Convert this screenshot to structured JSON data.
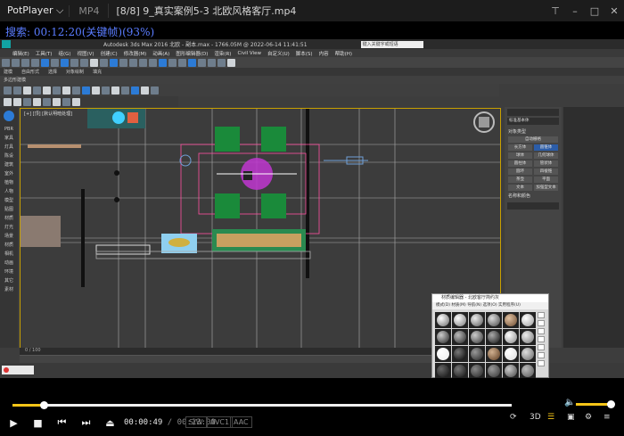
{
  "player": {
    "brand": "PotPlayer",
    "format": "MP4",
    "file_title": "[8/8] 9_真实案例5-3 北欧风格客厅.mp4",
    "osd_text": "搜索: 00:12:20(关键帧)(93%)",
    "current_time": "00:00:49",
    "total_time": "00:13:09",
    "codecs": [
      "S/W",
      "AVC1",
      "AAC"
    ],
    "progress_fraction": 0.062,
    "volume_fraction": 1.0,
    "colors": {
      "accent": "#f5c518",
      "osd": "#5a7cff"
    }
  },
  "max": {
    "title": "Autodesk 3ds Max 2016    北欧 - 副本.max - 1766.05M @ 2022-06-14 11:41:51",
    "search_placeholder": "键入关键字或短语",
    "menu": [
      "编辑(E)",
      "工具(T)",
      "组(G)",
      "视图(V)",
      "创建(C)",
      "修改器(M)",
      "动画(A)",
      "图形编辑器(D)",
      "渲染(R)",
      "Civil View",
      "自定义(U)",
      "脚本(S)",
      "内容",
      "帮助(H)"
    ],
    "ribbon_tabs": [
      "建模",
      "自由形式",
      "选择",
      "对象绘制",
      "填充"
    ],
    "subtab": "多边形建模",
    "left_nav": [
      "PBR",
      "家具",
      "灯具",
      "陈设",
      "建筑",
      "室外",
      "植物",
      "人物",
      "模型",
      "贴图",
      "材质",
      "灯光",
      "场景",
      "材质",
      "相机",
      "动画",
      "环境",
      "其它",
      "素材"
    ],
    "viewport_label": "[+] [顶] [默认明暗处理]",
    "timeline_label": "0 / 100",
    "cmd_panel": {
      "object_type_header": "对象类型",
      "dropdown": "标准基本体",
      "autogrid": "自动栅格",
      "buttons": [
        "长方体",
        "圆锥体",
        "球体",
        "几何球体",
        "圆柱体",
        "管状体",
        "圆环",
        "四棱锥",
        "茶壶",
        "平面",
        "文本",
        "加强型文本"
      ],
      "name_color_header": "名称和颜色"
    },
    "material_editor": {
      "title": "材质编辑器 - 北欧客厅简约灰",
      "menu": "模式(D)  材质(M)  导航(N)  选项(O)  实用程序(U)"
    }
  }
}
